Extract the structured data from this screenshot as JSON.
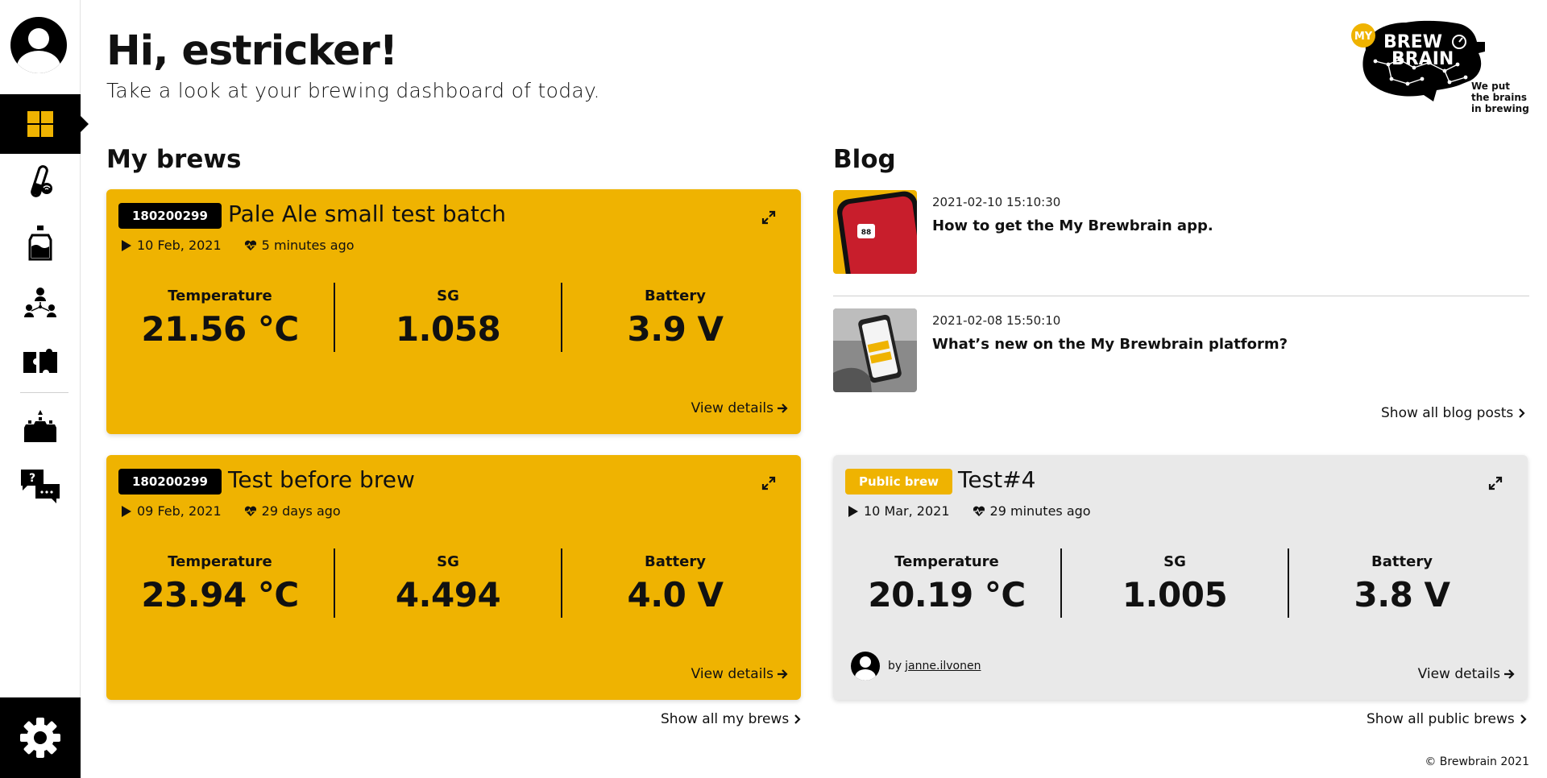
{
  "header": {
    "greeting_prefix": "Hi,",
    "username": "estricker!",
    "subtitle": "Take a look at your brewing dashboard of today."
  },
  "logo": {
    "badge": "MY",
    "line1": "BREW",
    "line2": "BRAIN",
    "tagline1": "We put",
    "tagline2": "the brains",
    "tagline3": "in brewing"
  },
  "sidebar": {
    "items": [
      {
        "icon": "dashboard-icon"
      },
      {
        "icon": "hydrometer-icon"
      },
      {
        "icon": "fermenter-icon"
      },
      {
        "icon": "community-icon"
      },
      {
        "icon": "integrations-icon"
      },
      {
        "icon": "public-brews-icon"
      },
      {
        "icon": "help-chat-icon"
      }
    ],
    "settings_icon": "gear-icon"
  },
  "my_brews": {
    "section_title": "My brews",
    "show_all": "Show all my brews",
    "cards": [
      {
        "id": "180200299",
        "title": "Pale Ale small test batch",
        "start_date": "10 Feb, 2021",
        "last_seen": "5 minutes ago",
        "temperature_label": "Temperature",
        "temperature": "21.56 °C",
        "sg_label": "SG",
        "sg": "1.058",
        "battery_label": "Battery",
        "battery": "3.9 V",
        "view_details": "View details"
      },
      {
        "id": "180200299",
        "title": "Test before brew",
        "start_date": "09 Feb, 2021",
        "last_seen": "29 days ago",
        "temperature_label": "Temperature",
        "temperature": "23.94 °C",
        "sg_label": "SG",
        "sg": "4.494",
        "battery_label": "Battery",
        "battery": "4.0 V",
        "view_details": "View details"
      }
    ]
  },
  "blog": {
    "section_title": "Blog",
    "show_all": "Show all blog posts",
    "posts": [
      {
        "date": "2021-02-10 15:10:30",
        "title": "How to get the My Brewbrain app."
      },
      {
        "date": "2021-02-08 15:50:10",
        "title": "What’s new on the My Brewbrain platform?"
      }
    ]
  },
  "public_brew": {
    "tag": "Public brew",
    "title": "Test#4",
    "start_date": "10 Mar, 2021",
    "last_seen": "29 minutes ago",
    "temperature_label": "Temperature",
    "temperature": "20.19 °C",
    "sg_label": "SG",
    "sg": "1.005",
    "battery_label": "Battery",
    "battery": "3.8 V",
    "by_prefix": "by",
    "author": "janne.ilvonen",
    "view_details": "View details",
    "show_all": "Show all public brews"
  },
  "footer": {
    "copyright": "© Brewbrain 2021"
  },
  "colors": {
    "accent": "#EFB301",
    "dark": "#000000",
    "card_grey": "#e9e9e9"
  }
}
